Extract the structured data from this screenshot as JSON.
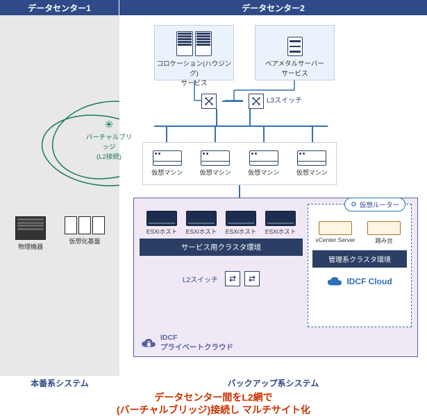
{
  "headers": {
    "dc1": "データセンター1",
    "dc2": "データセンター2"
  },
  "services": {
    "colo": "コロケーション(ハウジング)\nサービス",
    "baremetal": "ベアメタルサーバー\nサービス"
  },
  "l3": "L3スイッチ",
  "vbridge": "バーチャルブリッジ\n(L2接続)",
  "dc1_items": {
    "phys": "物理機器",
    "virt": "仮想化基盤"
  },
  "vm_label": "仮想マシン",
  "esxi_label": "ESXiホスト",
  "service_cluster": "サービス用クラスタ環境",
  "l2": "L2スイッチ",
  "mgmt": {
    "vr": "仮想ルーター",
    "vc": "vCenter Server",
    "jump": "踏み台",
    "cluster": "管理系クラスタ環境",
    "idcf": "IDCF Cloud"
  },
  "pc_logo": "IDCF\nプライベートクラウド",
  "footers": {
    "f1": "本番系システム",
    "f2": "バックアップ系システム"
  },
  "caption": "データセンター間をL2網で\n(バーチャルブリッジ)接続し マルチサイト化"
}
